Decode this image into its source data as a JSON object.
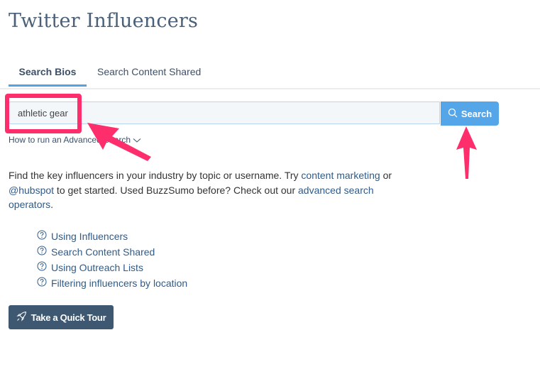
{
  "page": {
    "title": "Twitter Influencers"
  },
  "tabs": [
    {
      "label": "Search Bios",
      "active": true
    },
    {
      "label": "Search Content Shared",
      "active": false
    }
  ],
  "search": {
    "value": "athletic gear",
    "placeholder": "",
    "button_label": "Search",
    "button_icon": "search-icon",
    "advanced_link": "How to run an Advanced Search",
    "advanced_icon": "chevron-down-icon"
  },
  "intro": {
    "part1": "Find the key influencers in your industry by topic or username. Try ",
    "link1": "content marketing",
    "part2": " or ",
    "link2": "@hubspot",
    "part3": " to get started. Used BuzzSumo before? Check out our ",
    "link3": "advanced search operators",
    "part4": "."
  },
  "help_links": [
    {
      "label": "Using Influencers",
      "icon": "help-circle-icon"
    },
    {
      "label": "Search Content Shared",
      "icon": "help-circle-icon"
    },
    {
      "label": "Using Outreach Lists",
      "icon": "help-circle-icon"
    },
    {
      "label": "Filtering influencers by location",
      "icon": "help-circle-icon"
    }
  ],
  "tour_button": {
    "label": "Take a Quick Tour",
    "icon": "rocket-icon"
  },
  "colors": {
    "accent": "#55a6e8",
    "annotation": "#fe2e6c",
    "tour_button": "#3d5870",
    "link": "#2f5b8a"
  }
}
